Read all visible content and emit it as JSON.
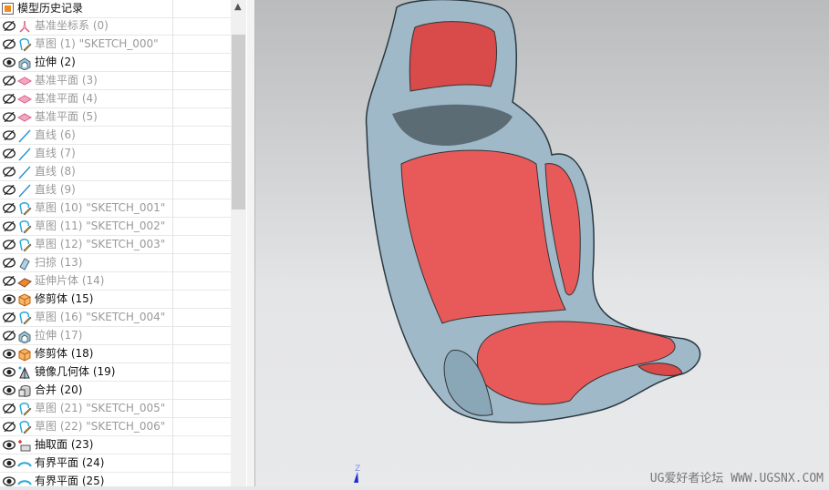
{
  "panel": {
    "title": "模型历史记录",
    "items": [
      {
        "label": "基准坐标系 (0)",
        "visible": false,
        "icon": "datum-csys-icon"
      },
      {
        "label": "草图 (1) \"SKETCH_000\"",
        "visible": false,
        "icon": "sketch-icon"
      },
      {
        "label": "拉伸 (2)",
        "visible": true,
        "icon": "extrude-icon"
      },
      {
        "label": "基准平面 (3)",
        "visible": false,
        "icon": "datum-plane-icon"
      },
      {
        "label": "基准平面 (4)",
        "visible": false,
        "icon": "datum-plane-icon"
      },
      {
        "label": "基准平面 (5)",
        "visible": false,
        "icon": "datum-plane-icon"
      },
      {
        "label": "直线 (6)",
        "visible": false,
        "icon": "line-icon"
      },
      {
        "label": "直线 (7)",
        "visible": false,
        "icon": "line-icon"
      },
      {
        "label": "直线 (8)",
        "visible": false,
        "icon": "line-icon"
      },
      {
        "label": "直线 (9)",
        "visible": false,
        "icon": "line-icon"
      },
      {
        "label": "草图 (10) \"SKETCH_001\"",
        "visible": false,
        "icon": "sketch-icon"
      },
      {
        "label": "草图 (11) \"SKETCH_002\"",
        "visible": false,
        "icon": "sketch-icon"
      },
      {
        "label": "草图 (12) \"SKETCH_003\"",
        "visible": false,
        "icon": "sketch-icon"
      },
      {
        "label": "扫掠 (13)",
        "visible": false,
        "icon": "sweep-icon"
      },
      {
        "label": "延伸片体 (14)",
        "visible": false,
        "icon": "extend-sheet-icon"
      },
      {
        "label": "修剪体 (15)",
        "visible": true,
        "icon": "trim-body-icon"
      },
      {
        "label": "草图 (16) \"SKETCH_004\"",
        "visible": false,
        "icon": "sketch-icon"
      },
      {
        "label": "拉伸 (17)",
        "visible": false,
        "icon": "extrude-icon"
      },
      {
        "label": "修剪体 (18)",
        "visible": true,
        "icon": "trim-body-icon"
      },
      {
        "label": "镜像几何体 (19)",
        "visible": true,
        "icon": "mirror-geometry-icon"
      },
      {
        "label": "合并 (20)",
        "visible": true,
        "icon": "unite-icon"
      },
      {
        "label": "草图 (21) \"SKETCH_005\"",
        "visible": false,
        "icon": "sketch-icon"
      },
      {
        "label": "草图 (22) \"SKETCH_006\"",
        "visible": false,
        "icon": "sketch-icon"
      },
      {
        "label": "抽取面 (23)",
        "visible": true,
        "icon": "extract-face-icon"
      },
      {
        "label": "有界平面 (24)",
        "visible": true,
        "icon": "bounded-plane-icon"
      },
      {
        "label": "有界平面 (25)",
        "visible": true,
        "icon": "bounded-plane-icon"
      }
    ]
  },
  "viewport": {
    "axis_label": "Z",
    "watermark": "UG爱好者论坛 WWW.UGSNX.COM",
    "shell_color": "#9fb9c9",
    "face_color": "#e85a5a"
  }
}
